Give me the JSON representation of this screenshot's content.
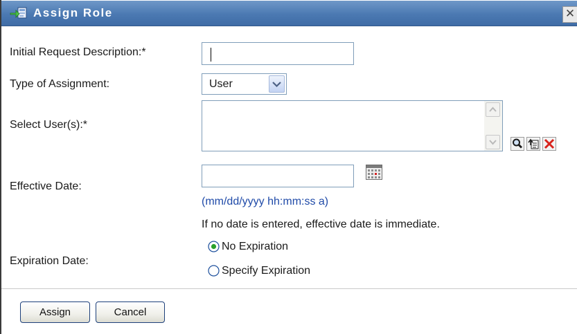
{
  "dialog": {
    "title": "Assign Role",
    "close_glyph": "✕"
  },
  "form": {
    "description_label": "Initial Request Description:*",
    "description_value": "",
    "assignment_label": "Type of Assignment:",
    "assignment_value": "User",
    "users_label": "Select User(s):*",
    "effective_label": "Effective Date:",
    "effective_value": "",
    "date_format_hint": "(mm/dd/yyyy hh:mm:ss a)",
    "effective_note": "If no date is entered, effective date is immediate.",
    "expiration_label": "Expiration Date:",
    "expiration_options": [
      {
        "label": "No Expiration",
        "selected": true
      },
      {
        "label": "Specify Expiration",
        "selected": false
      }
    ]
  },
  "icons": {
    "title": "assign-role-icon",
    "search": "magnifier-icon",
    "history": "history-list-icon",
    "clear": "red-x-icon",
    "calendar": "calendar-icon"
  },
  "footer": {
    "assign_label": "Assign",
    "cancel_label": "Cancel"
  },
  "colors": {
    "titlebar": "#4b79b2",
    "button_border": "#1c3f7a",
    "input_border": "#7f9db9"
  }
}
